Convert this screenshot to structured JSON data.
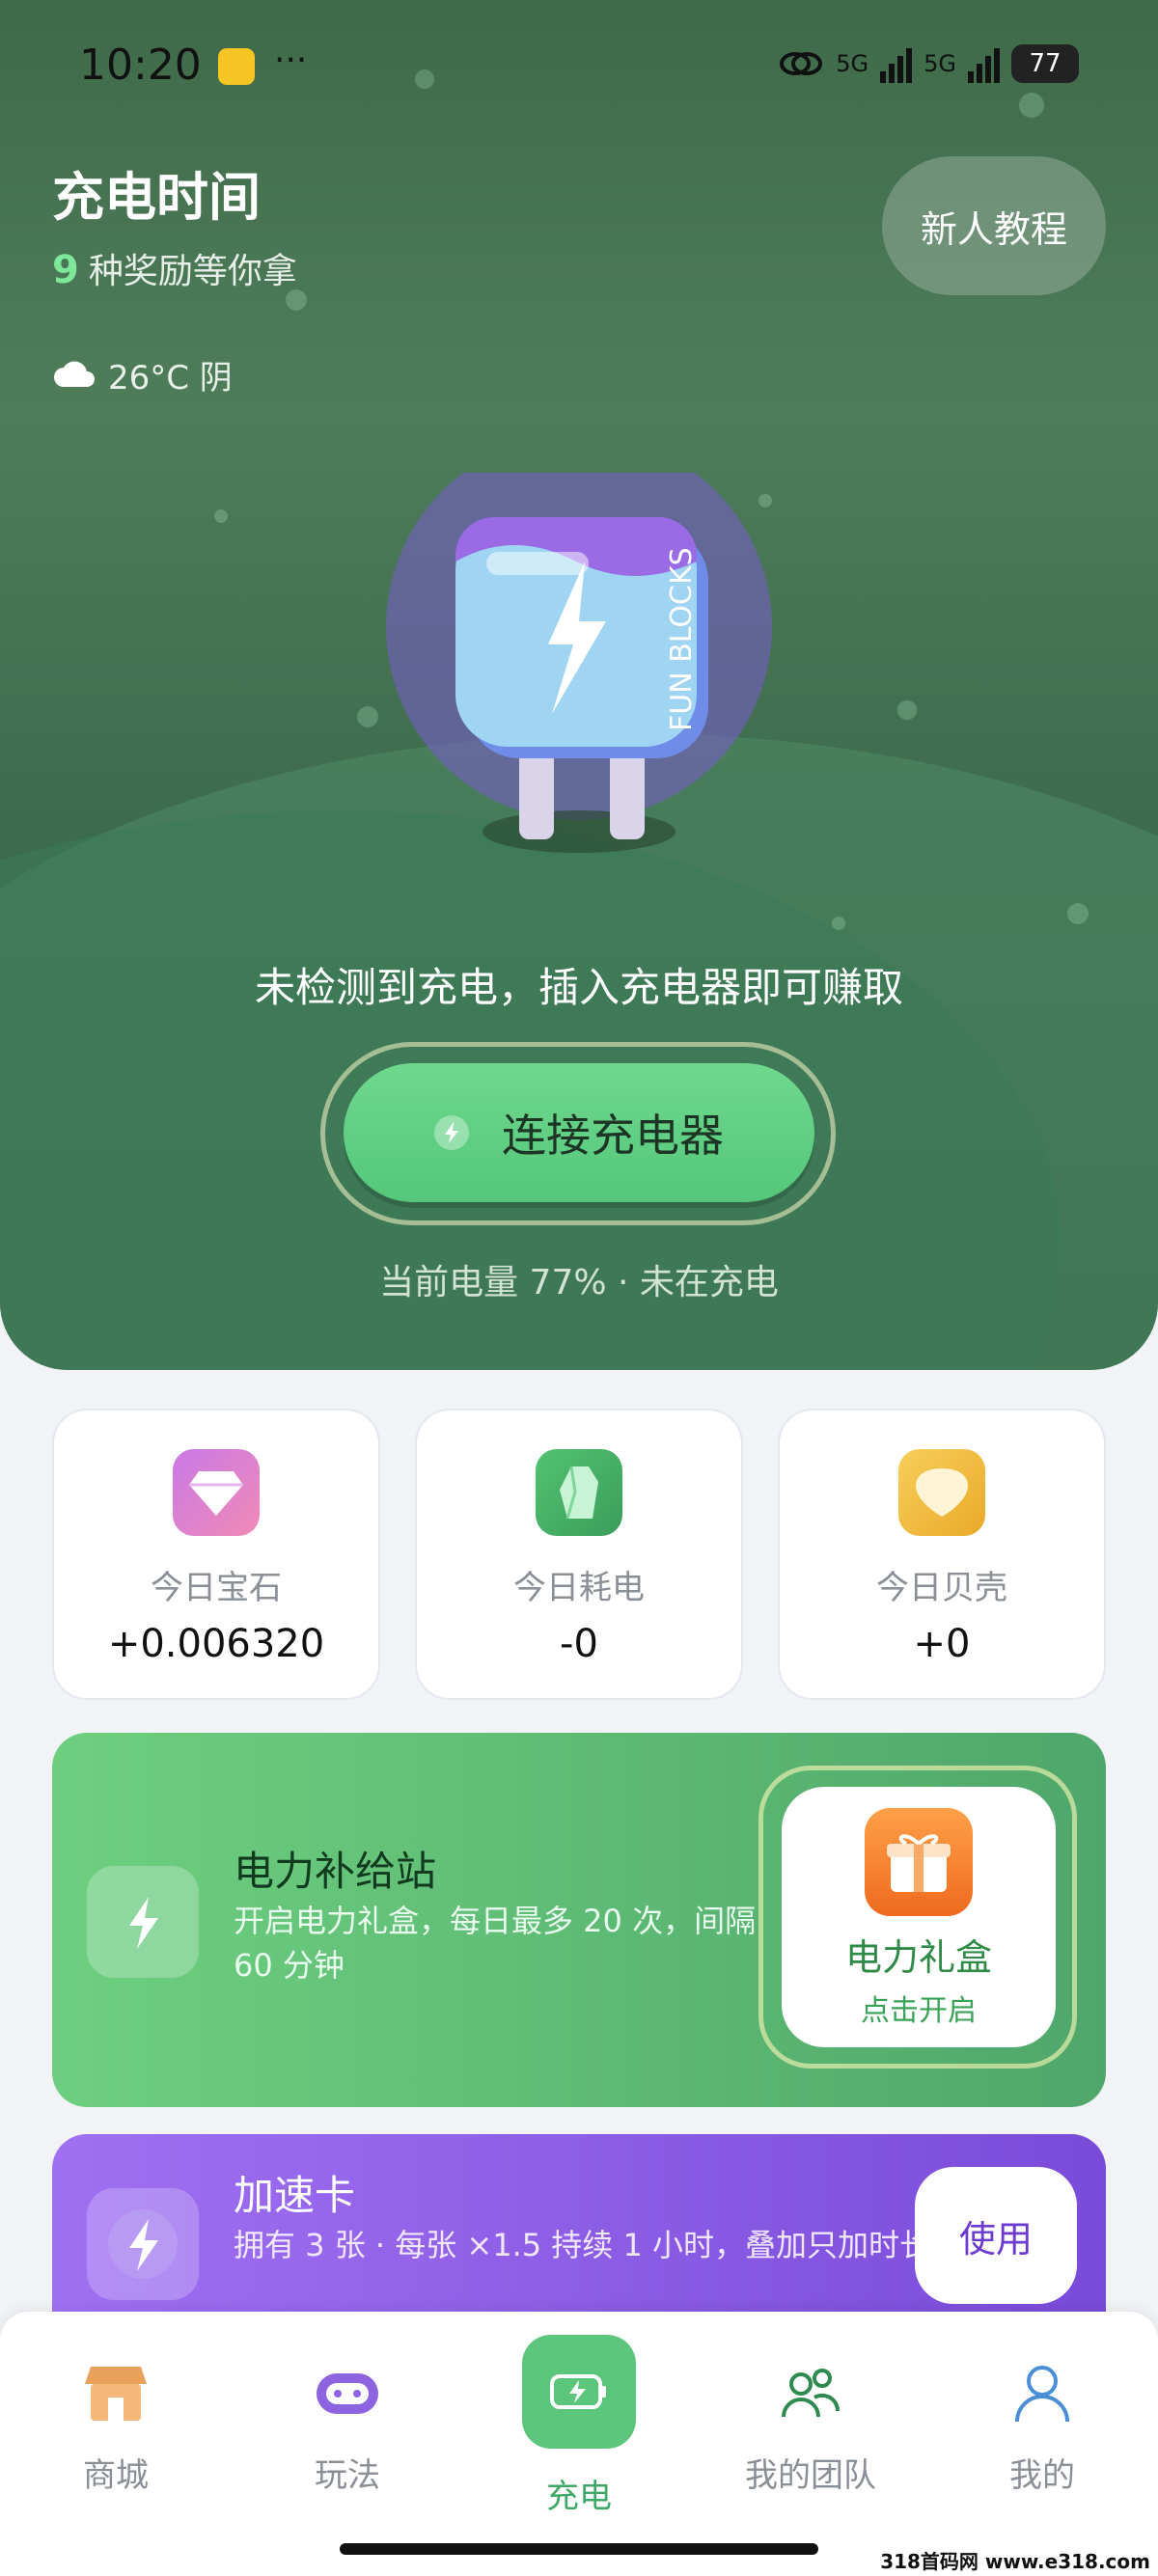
{
  "status_bar": {
    "time": "10:20",
    "dots": "···",
    "battery": "77",
    "net1": "5G",
    "net2": "5G"
  },
  "header": {
    "title": "充电时间",
    "reward_count": "9",
    "reward_text": "种奖励等你拿",
    "weather": "26°C 阴",
    "tutorial_button": "新人教程",
    "mascot_text": "FUN BLOCKS"
  },
  "charging": {
    "message": "未检测到充电，插入充电器即可赚取",
    "connect_button": "连接充电器",
    "power_status": "当前电量 77% · 未在充电",
    "battery_percent": 77
  },
  "stats": [
    {
      "label": "今日宝石",
      "value": "+0.006320",
      "icon": "gem-icon"
    },
    {
      "label": "今日耗电",
      "value": "-0",
      "icon": "crystal-icon"
    },
    {
      "label": "今日贝壳",
      "value": "+0",
      "icon": "shell-icon"
    }
  ],
  "power_station": {
    "title": "电力补给站",
    "description": "开启电力礼盒，每日最多 20 次，间隔 60 分钟",
    "gift_title": "电力礼盒",
    "gift_action": "点击开启"
  },
  "speed_card": {
    "title": "加速卡",
    "description": "拥有 3 张 · 每张 ×1.5 持续 1 小时，叠加只加时长",
    "use_button": "使用"
  },
  "tabs": [
    {
      "label": "商城",
      "icon": "store-icon"
    },
    {
      "label": "玩法",
      "icon": "gamepad-icon"
    },
    {
      "label": "充电",
      "icon": "battery-charge-icon"
    },
    {
      "label": "我的团队",
      "icon": "team-icon"
    },
    {
      "label": "我的",
      "icon": "user-icon"
    }
  ],
  "watermark": "318首码网 www.e318.com",
  "colors": {
    "accent": "#5bc57c",
    "hero": "#3f6a4a",
    "speed": "#8a5ce6",
    "gift": "#f07a2a"
  }
}
